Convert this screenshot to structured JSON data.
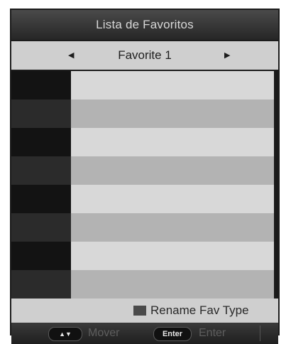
{
  "window": {
    "title": "Lista de Favoritos"
  },
  "selector": {
    "value": "Favorite 1",
    "left_arrow": "◀",
    "right_arrow": "▶"
  },
  "list": {
    "rows": [
      {
        "number": "",
        "name": ""
      },
      {
        "number": "",
        "name": ""
      },
      {
        "number": "",
        "name": ""
      },
      {
        "number": "",
        "name": ""
      },
      {
        "number": "",
        "name": ""
      },
      {
        "number": "",
        "name": ""
      },
      {
        "number": "",
        "name": ""
      },
      {
        "number": "",
        "name": ""
      }
    ]
  },
  "footer": {
    "rename_label": "Rename Fav Type",
    "move_key": "▲▼",
    "move_label": "Mover",
    "enter_key": "Enter",
    "enter_label": "Enter"
  },
  "colors": {
    "background": "#1c1c1c",
    "row_light": "#d8d8d8",
    "row_dark": "#b3b3b3",
    "number_column_dark": "#131313",
    "number_column_alt": "#2b2b2b"
  }
}
